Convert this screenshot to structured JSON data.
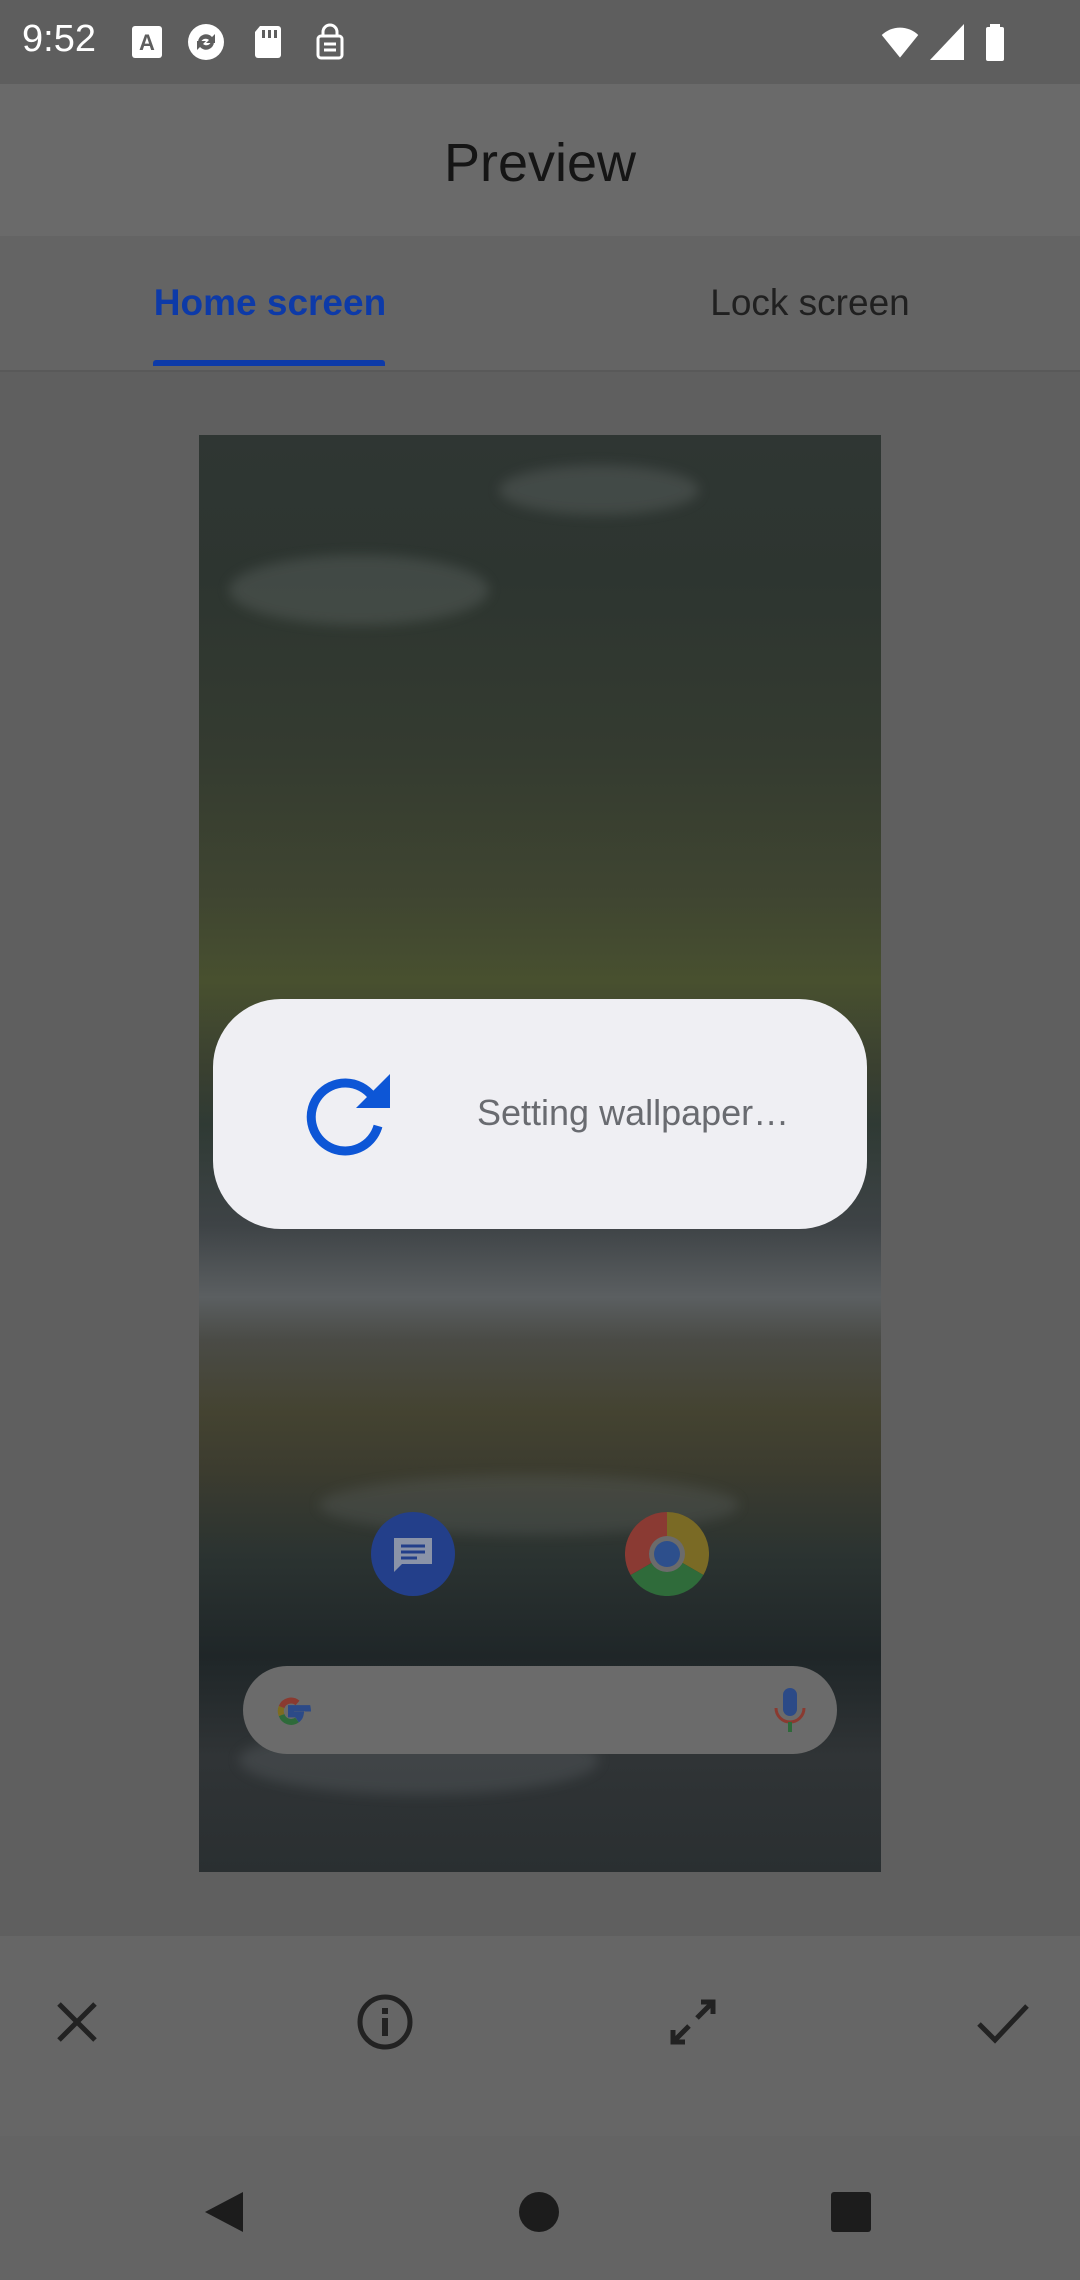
{
  "status_bar": {
    "time": "9:52",
    "left_icons": [
      "keyboard-a-icon",
      "sync-icon",
      "sd-card-icon",
      "vpn-icon"
    ],
    "right_icons": [
      "wifi-icon",
      "cell-signal-icon",
      "battery-icon"
    ]
  },
  "app_bar": {
    "title": "Preview"
  },
  "tabs": [
    {
      "label": "Home screen",
      "selected": true
    },
    {
      "label": "Lock screen",
      "selected": false
    }
  ],
  "preview": {
    "home_icons": [
      "messages-icon",
      "chrome-icon"
    ],
    "search_bar_icons": [
      "google-g-icon",
      "mic-icon"
    ]
  },
  "dialog": {
    "message": "Setting wallpaper…",
    "icon": "refresh-icon"
  },
  "actions": [
    {
      "name": "close",
      "icon": "close-icon"
    },
    {
      "name": "info",
      "icon": "info-icon"
    },
    {
      "name": "expand",
      "icon": "expand-icon"
    },
    {
      "name": "apply",
      "icon": "check-icon"
    }
  ],
  "nav_bar": [
    "back-icon",
    "home-icon",
    "recents-icon"
  ],
  "colors": {
    "accent": "#0d3aa8",
    "scrim": "#626262",
    "dialog_bg": "#efeff3"
  }
}
